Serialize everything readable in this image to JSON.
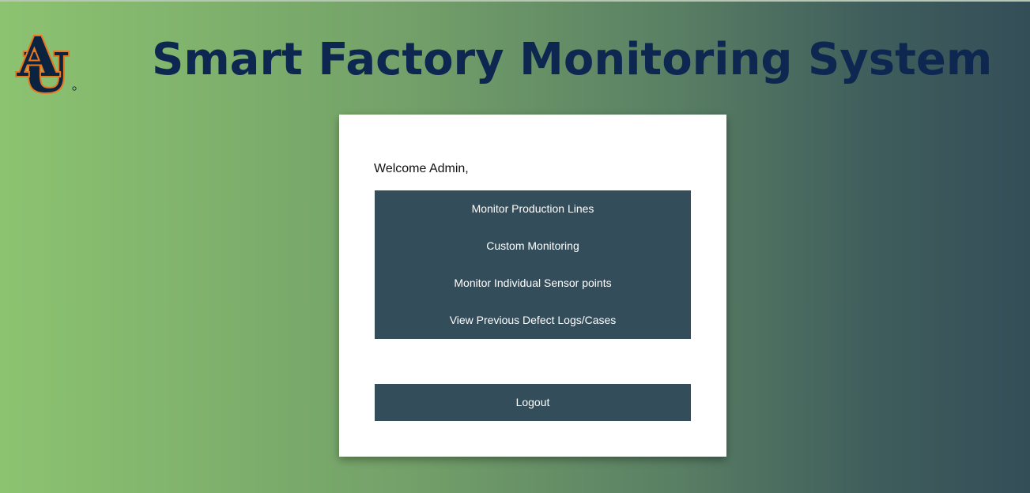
{
  "header": {
    "logo_text": "AU",
    "title": "Smart Factory Monitoring System"
  },
  "panel": {
    "welcome": "Welcome Admin,",
    "menu_items": [
      {
        "label": "Monitor Production Lines"
      },
      {
        "label": "Custom Monitoring"
      },
      {
        "label": "Monitor Individual Sensor points"
      },
      {
        "label": "View Previous Defect Logs/Cases"
      }
    ],
    "logout_label": "Logout"
  },
  "colors": {
    "title": "#0e2751",
    "button_bg": "#344d5a",
    "logo_navy": "#0c2340",
    "logo_orange": "#e87722",
    "gradient_start": "#8cc370",
    "gradient_end": "#344e58"
  }
}
